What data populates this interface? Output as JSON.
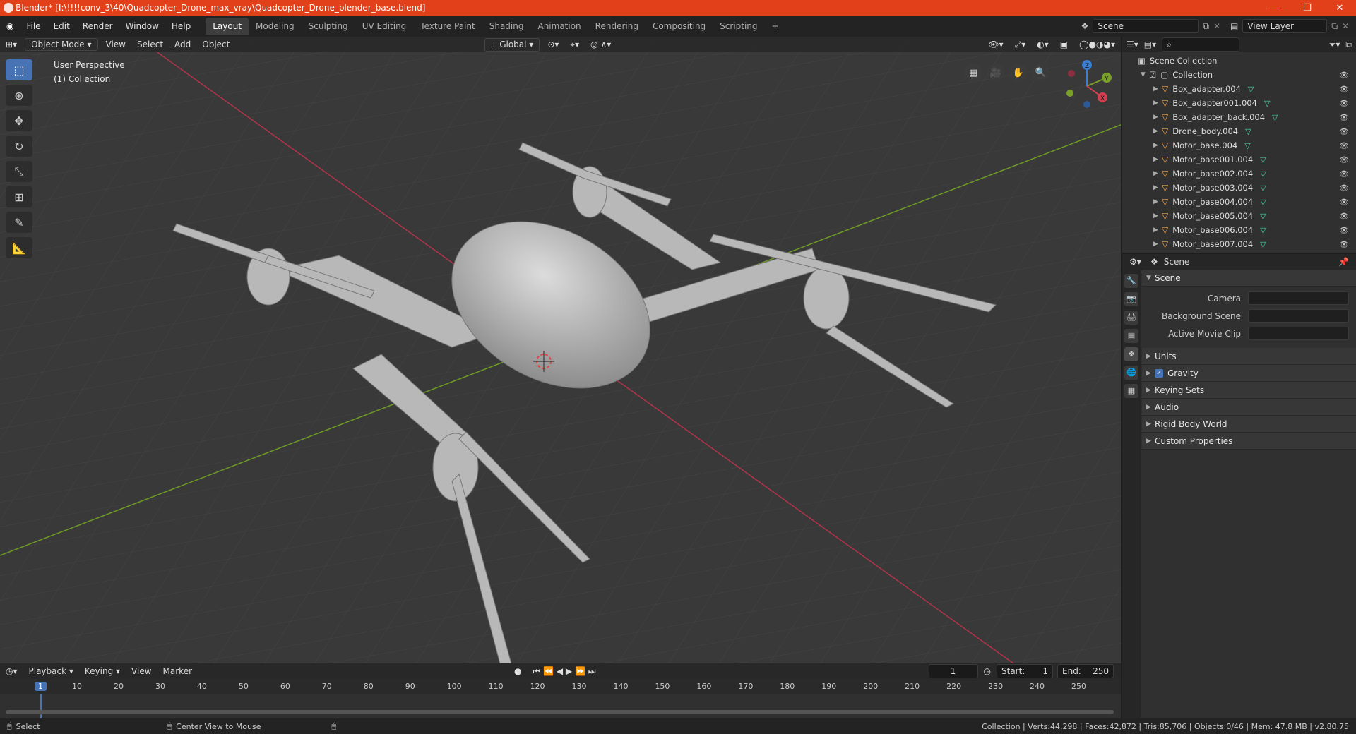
{
  "title_bar": {
    "title": "Blender* [I:\\!!!!conv_3\\40\\Quadcopter_Drone_max_vray\\Quadcopter_Drone_blender_base.blend]"
  },
  "top_menu": [
    "File",
    "Edit",
    "Render",
    "Window",
    "Help"
  ],
  "workspace_tabs": [
    "Layout",
    "Modeling",
    "Sculpting",
    "UV Editing",
    "Texture Paint",
    "Shading",
    "Animation",
    "Rendering",
    "Compositing",
    "Scripting"
  ],
  "active_workspace": "Layout",
  "scene_field": "Scene",
  "view_layer_field": "View Layer",
  "viewport": {
    "mode": "Object Mode",
    "menus": [
      "View",
      "Select",
      "Add",
      "Object"
    ],
    "orientation": "Global",
    "overlay_line1": "User Perspective",
    "overlay_line2": "(1) Collection",
    "gizmo": {
      "x": "X",
      "y": "Y",
      "z": "Z"
    }
  },
  "outliner": {
    "root": "Scene Collection",
    "collection": "Collection",
    "items": [
      "Box_adapter.004",
      "Box_adapter001.004",
      "Box_adapter_back.004",
      "Drone_body.004",
      "Motor_base.004",
      "Motor_base001.004",
      "Motor_base002.004",
      "Motor_base003.004",
      "Motor_base004.004",
      "Motor_base005.004",
      "Motor_base006.004",
      "Motor_base007.004"
    ]
  },
  "properties": {
    "header": "Scene",
    "section": "Scene",
    "camera_label": "Camera",
    "background_scene_label": "Background Scene",
    "active_movie_clip_label": "Active Movie Clip",
    "subsections": [
      "Units",
      "Gravity",
      "Keying Sets",
      "Audio",
      "Rigid Body World",
      "Custom Properties"
    ]
  },
  "timeline": {
    "menus": [
      "Playback",
      "Keying",
      "View",
      "Marker"
    ],
    "current_frame": "1",
    "start_label": "Start:",
    "start": "1",
    "end_label": "End:",
    "end": "250",
    "ticks": [
      "1",
      "10",
      "20",
      "30",
      "40",
      "50",
      "60",
      "70",
      "80",
      "90",
      "100",
      "110",
      "120",
      "130",
      "140",
      "150",
      "160",
      "170",
      "180",
      "190",
      "200",
      "210",
      "220",
      "230",
      "240",
      "250"
    ]
  },
  "status_bar": {
    "left1": "Select",
    "left2": "Center View to Mouse",
    "right": "Collection | Verts:44,298 | Faces:42,872 | Tris:85,706 | Objects:0/46 | Mem: 47.8 MB | v2.80.75"
  },
  "colors": {
    "title_bar": "#e2401a",
    "active_tool": "#4772b3",
    "x_axis": "#d04050",
    "y_axis": "#7aa02a",
    "mesh_icon": "#f3a046"
  }
}
